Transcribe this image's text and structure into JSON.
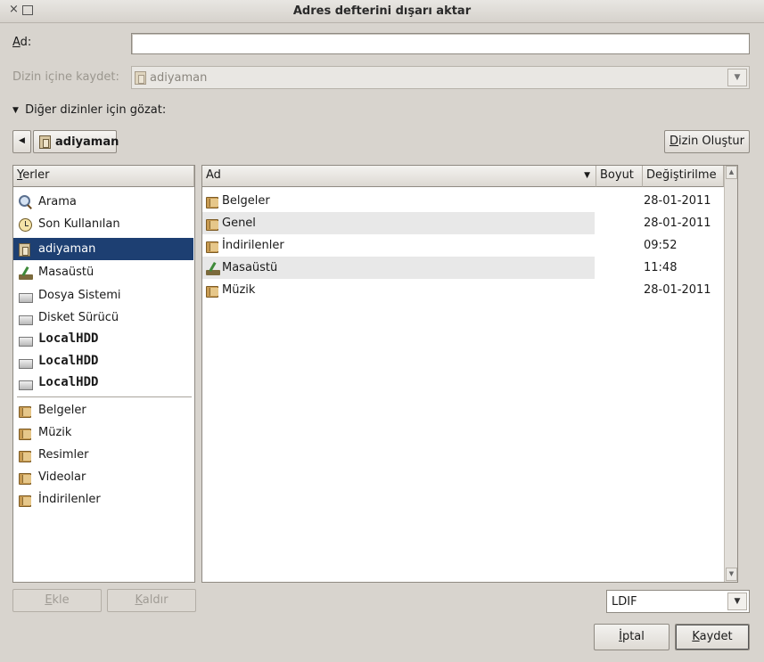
{
  "window": {
    "title": "Adres defterini dışarı aktar"
  },
  "name_field": {
    "label_u": "A",
    "label_rest": "d:",
    "value": ""
  },
  "save_in": {
    "label": "Dizin içine kaydet:",
    "value": "adiyaman"
  },
  "browse": {
    "label": "Diğer dizinler için gözat:"
  },
  "path": {
    "current": "adiyaman"
  },
  "create_folder": {
    "label_u": "D",
    "label_rest": "izin Oluştur"
  },
  "places": {
    "header_u": "Y",
    "header_rest": "erler",
    "items": [
      {
        "label": "Arama",
        "icon": "search-icon"
      },
      {
        "label": "Son Kullanılan",
        "icon": "clock-icon"
      },
      {
        "label": "adiyaman",
        "icon": "home-folder-icon"
      },
      {
        "label": "Masaüstü",
        "icon": "desktop-icon"
      },
      {
        "label": "Dosya Sistemi",
        "icon": "drive-icon"
      },
      {
        "label": "Disket Sürücü",
        "icon": "drive-icon"
      },
      {
        "label": "LocalHDD",
        "icon": "drive-icon"
      },
      {
        "label": "LocalHDD",
        "icon": "drive-icon"
      },
      {
        "label": "LocalHDD",
        "icon": "drive-icon"
      }
    ],
    "bookmarks": [
      {
        "label": "Belgeler",
        "icon": "folder-icon"
      },
      {
        "label": "Müzik",
        "icon": "folder-icon"
      },
      {
        "label": "Resimler",
        "icon": "folder-icon"
      },
      {
        "label": "Videolar",
        "icon": "folder-icon"
      },
      {
        "label": "İndirilenler",
        "icon": "folder-icon"
      }
    ]
  },
  "files": {
    "columns": {
      "name": "Ad",
      "size": "Boyut",
      "modified": "Değiştirilme"
    },
    "rows": [
      {
        "name": "Belgeler",
        "modified": "28-01-2011",
        "icon": "folder-icon"
      },
      {
        "name": "Genel",
        "modified": "28-01-2011",
        "icon": "folder-icon"
      },
      {
        "name": "İndirilenler",
        "modified": "09:52",
        "icon": "folder-icon"
      },
      {
        "name": "Masaüstü",
        "modified": "11:48",
        "icon": "desktop-icon"
      },
      {
        "name": "Müzik",
        "modified": "28-01-2011",
        "icon": "folder-icon"
      }
    ]
  },
  "buttons": {
    "add_u": "E",
    "add_rest": "kle",
    "remove_u": "K",
    "remove_rest": "aldır",
    "cancel_u": "İ",
    "cancel_rest": "ptal",
    "save_u": "K",
    "save_rest": "aydet"
  },
  "format": {
    "value": "LDIF"
  },
  "colors": {
    "selection": "#1d3f72",
    "window_bg": "#d8d4ce"
  }
}
